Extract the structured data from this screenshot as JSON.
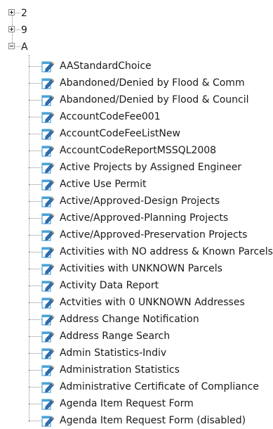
{
  "tree": {
    "top_nodes": [
      {
        "label": "2",
        "state": "collapsed"
      },
      {
        "label": "9",
        "state": "collapsed"
      },
      {
        "label": "A",
        "state": "expanded"
      }
    ],
    "children": [
      {
        "label": "AAStandardChoice"
      },
      {
        "label": "Abandoned/Denied by Flood & Comm"
      },
      {
        "label": "Abandoned/Denied by Flood & Council"
      },
      {
        "label": "AccountCodeFee001"
      },
      {
        "label": "AccountCodeFeeListNew"
      },
      {
        "label": "AccountCodeReportMSSQL2008"
      },
      {
        "label": "Active Projects by Assigned Engineer"
      },
      {
        "label": "Active Use Permit"
      },
      {
        "label": "Active/Approved-Design Projects"
      },
      {
        "label": "Active/Approved-Planning Projects"
      },
      {
        "label": "Active/Approved-Preservation Projects"
      },
      {
        "label": "Activities with NO address & Known Parcels"
      },
      {
        "label": "Activities with UNKNOWN Parcels"
      },
      {
        "label": "Activity Data Report"
      },
      {
        "label": "Actvities with 0 UNKNOWN Addresses"
      },
      {
        "label": "Address Change Notification"
      },
      {
        "label": "Address Range Search"
      },
      {
        "label": "Admin Statistics-Indiv"
      },
      {
        "label": "Administration Statistics"
      },
      {
        "label": "Administrative Certificate of Compliance"
      },
      {
        "label": "Agenda Item Request Form"
      },
      {
        "label": "Agenda Item Request Form (disabled)"
      }
    ],
    "child_icon": "report-edit-icon",
    "colors": {
      "icon_page": "#4aa3d8",
      "icon_pencil": "#2f6fb0",
      "lines": "#8a8a8a",
      "text": "#1a1a1a"
    }
  }
}
